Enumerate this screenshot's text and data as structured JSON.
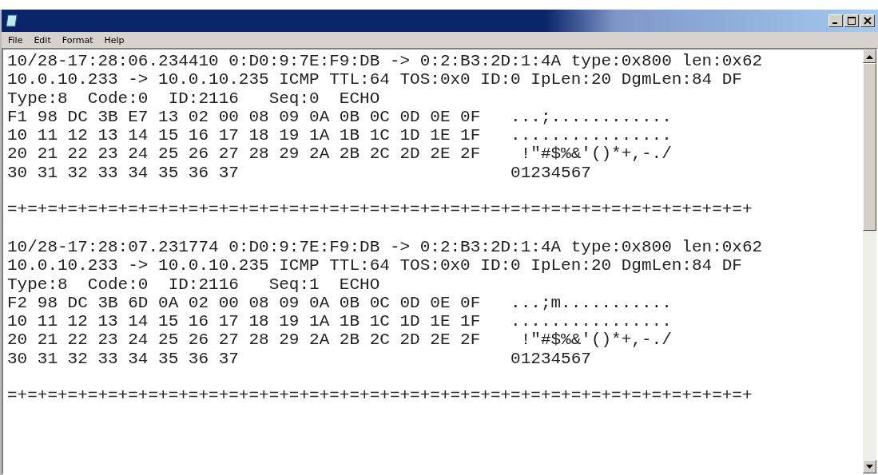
{
  "menu": [
    {
      "label": "File"
    },
    {
      "label": "Edit"
    },
    {
      "label": "Format"
    },
    {
      "label": "Help"
    }
  ],
  "packets": [
    {
      "header": "10/28-17:28:06.234410 0:D0:9:7E:F9:DB -> 0:2:B3:2D:1:4A type:0x800 len:0x62",
      "ip": "10.0.10.233 -> 10.0.10.235 ICMP TTL:64 TOS:0x0 ID:0 IpLen:20 DgmLen:84 DF",
      "icmp": "Type:8  Code:0  ID:2116   Seq:0  ECHO",
      "hex_rows": [
        "F1 98 DC 3B E7 13 02 00 08 09 0A 0B 0C 0D 0E 0F   ...;............",
        "10 11 12 13 14 15 16 17 18 19 1A 1B 1C 1D 1E 1F   ................",
        "20 21 22 23 24 25 26 27 28 29 2A 2B 2C 2D 2E 2F    !\"#$%&'()*+,-./",
        "30 31 32 33 34 35 36 37                           01234567"
      ],
      "separator": "=+=+=+=+=+=+=+=+=+=+=+=+=+=+=+=+=+=+=+=+=+=+=+=+=+=+=+=+=+=+=+=+=+=+=+=+=+"
    },
    {
      "header": "10/28-17:28:07.231774 0:D0:9:7E:F9:DB -> 0:2:B3:2D:1:4A type:0x800 len:0x62",
      "ip": "10.0.10.233 -> 10.0.10.235 ICMP TTL:64 TOS:0x0 ID:0 IpLen:20 DgmLen:84 DF",
      "icmp": "Type:8  Code:0  ID:2116   Seq:1  ECHO",
      "hex_rows": [
        "F2 98 DC 3B 6D 0A 02 00 08 09 0A 0B 0C 0D 0E 0F   ...;m...........",
        "10 11 12 13 14 15 16 17 18 19 1A 1B 1C 1D 1E 1F   ................",
        "20 21 22 23 24 25 26 27 28 29 2A 2B 2C 2D 2E 2F    !\"#$%&'()*+,-./",
        "30 31 32 33 34 35 36 37                           01234567"
      ],
      "separator": "=+=+=+=+=+=+=+=+=+=+=+=+=+=+=+=+=+=+=+=+=+=+=+=+=+=+=+=+=+=+=+=+=+=+=+=+=+"
    }
  ]
}
